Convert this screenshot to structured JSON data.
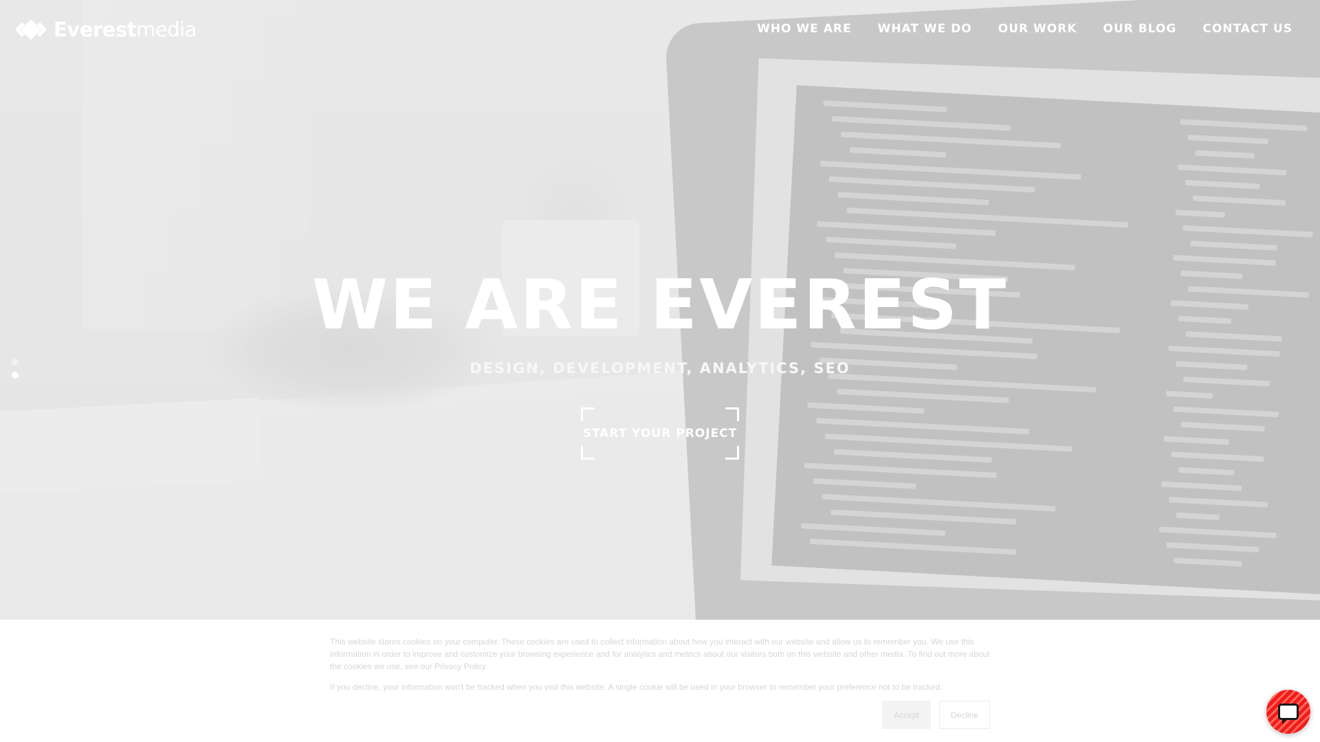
{
  "header": {
    "logo": {
      "bold": "Everest",
      "light": "media"
    },
    "nav": [
      "WHO WE ARE",
      "WHAT WE DO",
      "OUR WORK",
      "OUR BLOG",
      "CONTACT US"
    ]
  },
  "hero": {
    "title": "WE ARE EVEREST",
    "subtitle": "DESIGN, DEVELOPMENT, ANALYTICS, SEO",
    "cta": "START YOUR PROJECT",
    "slides": {
      "count": 2,
      "active": 2
    }
  },
  "cookie_banner": {
    "paragraph1": "This website stores cookies on your computer. These cookies are used to collect information about how you interact with our website and allow us to remember you. We use this information in order to improve and customize your browsing experience and for analytics and metrics about our visitors both on this website and other media. To find out more about the cookies we use, see our",
    "privacy_link": "Privacy Policy",
    "paragraph2": "If you decline, your information won't be tracked when you visit this website. A single cookie will be used in your browser to remember your preference not to be tracked.",
    "accept": "Accept",
    "decline": "Decline"
  },
  "chat": {
    "icon": "chat-bubble-icon",
    "color": "#f21b1b"
  },
  "colors": {
    "text_on_hero": "#ffffff",
    "chat_accent": "#f21b1b"
  }
}
